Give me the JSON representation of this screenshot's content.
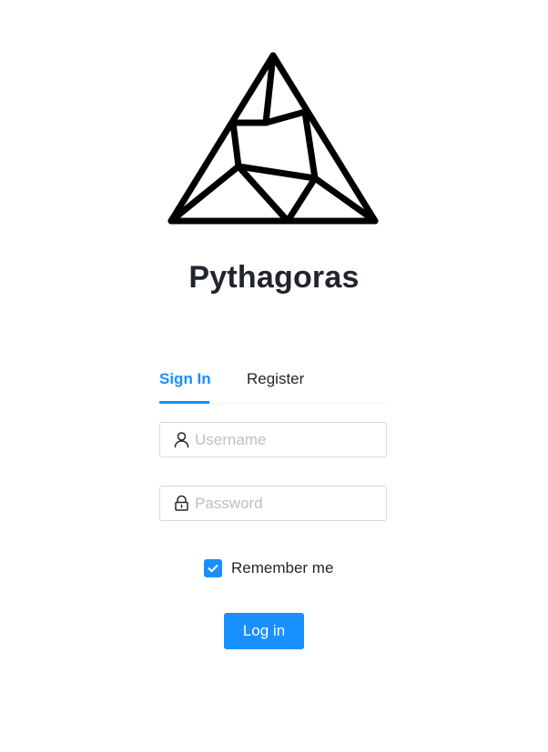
{
  "app": {
    "title": "Pythagoras",
    "logo_icon": "geometric-triangle-logo"
  },
  "tabs": [
    {
      "label": "Sign In",
      "active": true
    },
    {
      "label": "Register",
      "active": false
    }
  ],
  "form": {
    "username": {
      "placeholder": "Username",
      "value": "",
      "icon": "user-icon"
    },
    "password": {
      "placeholder": "Password",
      "value": "",
      "icon": "lock-icon"
    },
    "remember": {
      "label": "Remember me",
      "checked": true
    },
    "submit_label": "Log in"
  },
  "colors": {
    "accent": "#1890ff",
    "text": "#262626",
    "placeholder": "#bfbfbf",
    "border": "#d9d9d9"
  }
}
